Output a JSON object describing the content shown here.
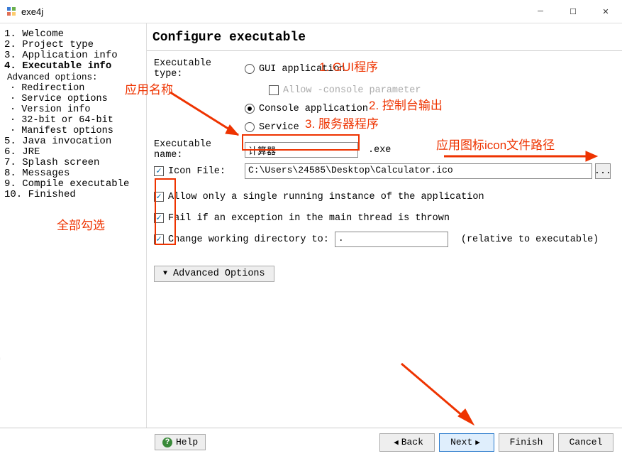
{
  "window": {
    "title": "exe4j",
    "watermark": "exe4j"
  },
  "steps": {
    "items": [
      "1. Welcome",
      "2. Project type",
      "3. Application info",
      "4. Executable info"
    ],
    "advancedHeader": "Advanced options:",
    "advanced": [
      "· Redirection",
      "· Service options",
      "· Version info",
      "· 32-bit or 64-bit",
      "· Manifest options"
    ],
    "rest": [
      "5. Java invocation",
      "6. JRE",
      "7. Splash screen",
      "8. Messages",
      "9. Compile executable",
      "10. Finished"
    ]
  },
  "content": {
    "header": "Configure executable",
    "execTypeLabel": "Executable type:",
    "guiLabel": "GUI application",
    "allowConsole": "Allow -console parameter",
    "consoleLabel": "Console application",
    "serviceLabel": "Service",
    "execNameLabel": "Executable name:",
    "execNameValue": "计算器",
    "exeSuffix": ".exe",
    "iconFileLabel": "Icon File:",
    "iconPath": "C:\\Users\\24585\\Desktop\\Calculator.ico",
    "browseDots": "...",
    "cb1": "Allow only a single running instance of the application",
    "cb2": "Fail if an exception in the main thread is thrown",
    "cb3Label": "Change working directory to:",
    "cb3Value": ".",
    "cb3Hint": "(relative to executable)",
    "advBtn": "Advanced Options"
  },
  "footer": {
    "help": "Help",
    "back": "Back",
    "next": "Next",
    "finish": "Finish",
    "cancel": "Cancel"
  },
  "annotations": {
    "appName": "应用名称",
    "gui": "1. GUI程序",
    "console": "2. 控制台输出",
    "service": "3. 服务器程序",
    "iconPath": "应用图标icon文件路径",
    "checkAll": "全部勾选"
  }
}
